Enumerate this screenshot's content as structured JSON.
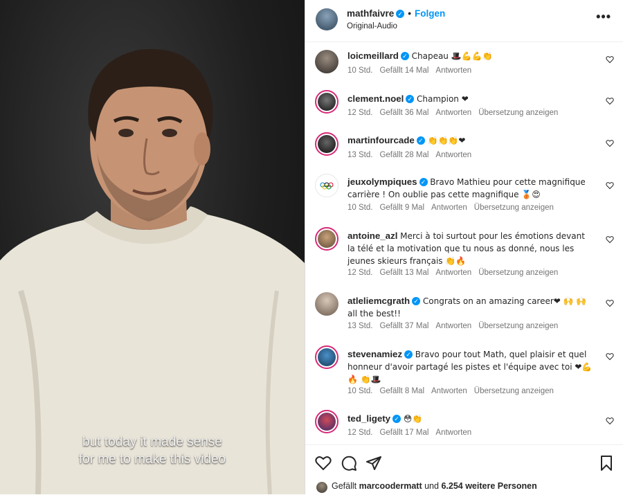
{
  "video": {
    "subtitle_line1": "but today it made sense",
    "subtitle_line2": "for me to make this video"
  },
  "header": {
    "username": "mathfaivre",
    "follow_label": "Folgen",
    "audio_label": "Original-Audio",
    "more_label": "•••"
  },
  "comments": [
    {
      "user": "loicmeillard",
      "text": "Chapeau 🎩💪💪👏",
      "time": "10 Std.",
      "likes": "Gefällt 14 Mal",
      "reply": "Antworten",
      "translate": ""
    },
    {
      "user": "clement.noel",
      "text": "Champion ❤",
      "time": "12 Std.",
      "likes": "Gefällt 36 Mal",
      "reply": "Antworten",
      "translate": "Übersetzung anzeigen"
    },
    {
      "user": "martinfourcade",
      "text": "👏👏👏❤",
      "time": "13 Std.",
      "likes": "Gefällt 28 Mal",
      "reply": "Antworten",
      "translate": ""
    },
    {
      "user": "jeuxolympiques",
      "text": "Bravo Mathieu pour cette magnifique carrière ! On oublie pas cette magnifique 🥉😍",
      "time": "10 Std.",
      "likes": "Gefällt 9 Mal",
      "reply": "Antworten",
      "translate": "Übersetzung anzeigen"
    },
    {
      "user": "antoine_azl",
      "text": "Merci à toi surtout pour les émotions devant la télé et la motivation que tu nous as donné, nous les jeunes skieurs français 👏🔥",
      "time": "12 Std.",
      "likes": "Gefällt 13 Mal",
      "reply": "Antworten",
      "translate": "Übersetzung anzeigen"
    },
    {
      "user": "atleliemcgrath",
      "text": "Congrats on an amazing career❤ 🙌 🙌 all the best!!",
      "time": "13 Std.",
      "likes": "Gefällt 37 Mal",
      "reply": "Antworten",
      "translate": "Übersetzung anzeigen"
    },
    {
      "user": "stevenamiez",
      "text": "Bravo pour tout Math, quel plaisir et quel honneur d'avoir partagé les pistes et l'équipe avec toi ❤💪🔥 👏🎩",
      "time": "10 Std.",
      "likes": "Gefällt 8 Mal",
      "reply": "Antworten",
      "translate": "Übersetzung anzeigen"
    },
    {
      "user": "ted_ligety",
      "text": "😳👏",
      "time": "12 Std.",
      "likes": "Gefällt 17 Mal",
      "reply": "Antworten",
      "translate": ""
    }
  ],
  "footer": {
    "likes_prefix": "Gefällt",
    "likes_user": "marcoodermatt",
    "likes_middle": "und",
    "likes_count": "6.254 weitere Personen"
  },
  "colors": {
    "accent": "#0095f6",
    "story_ring": "#d62976",
    "heart": "#ed4956"
  }
}
